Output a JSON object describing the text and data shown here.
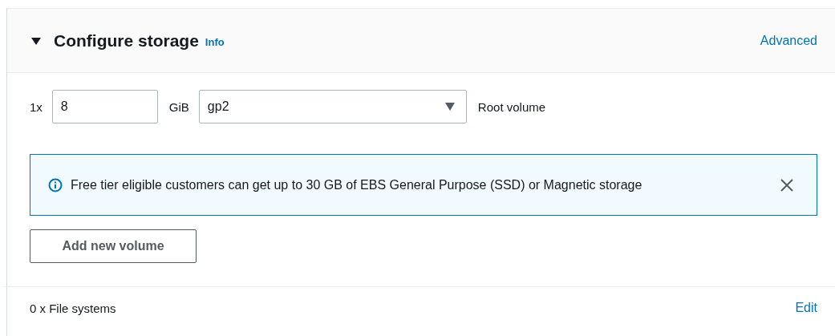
{
  "section": {
    "title": "Configure storage",
    "info": "Info",
    "expanded": true,
    "action": "Advanced"
  },
  "volume": {
    "count": "1x",
    "size": "8",
    "unit": "GiB",
    "type": "gp2",
    "description": "Root volume"
  },
  "alert": {
    "message": "Free tier eligible customers can get up to 30 GB of EBS General Purpose (SSD) or Magnetic storage"
  },
  "add_button": "Add new volume",
  "file_systems": {
    "label": "0 x File systems",
    "action": "Edit"
  }
}
